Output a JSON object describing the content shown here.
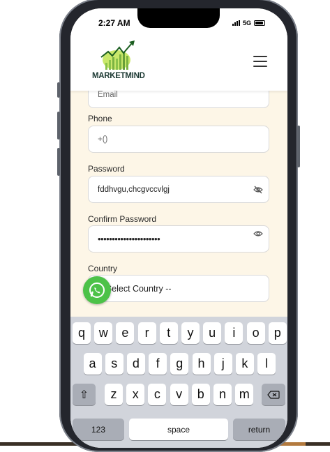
{
  "status_bar": {
    "time": "2:27 AM",
    "network": "5G"
  },
  "header": {
    "logo_text": "MARKETMIND",
    "menu_icon": "hamburger-menu-icon"
  },
  "form": {
    "email_placeholder": "Email",
    "phone_label": "Phone",
    "phone_value": "+()",
    "password_label": "Password",
    "password_value": "fddhvgu,chcgvccvlgj",
    "confirm_password_label": "Confirm Password",
    "confirm_password_value": "••••••••••••••••••••••",
    "country_label": "Country",
    "country_value": "-- Select Country --"
  },
  "floating": {
    "icon": "whatsapp-icon"
  },
  "keyboard": {
    "row1": [
      "q",
      "w",
      "e",
      "r",
      "t",
      "y",
      "u",
      "i",
      "o",
      "p"
    ],
    "row2": [
      "a",
      "s",
      "d",
      "f",
      "g",
      "h",
      "j",
      "k",
      "l"
    ],
    "row3": [
      "z",
      "x",
      "c",
      "v",
      "b",
      "n",
      "m"
    ],
    "shift_symbol": "⇧",
    "numbers_label": "123",
    "space_label": "space",
    "return_label": "return"
  },
  "colors": {
    "form_background": "#fdf6e7",
    "whatsapp_green": "#4cc248",
    "keyboard_background": "#d1d4db"
  }
}
